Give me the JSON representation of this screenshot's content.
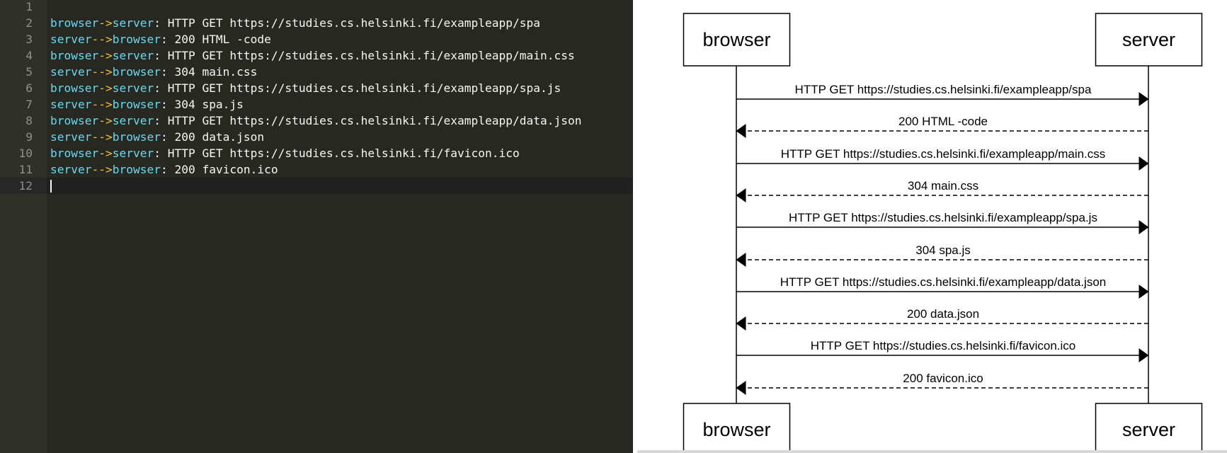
{
  "editor": {
    "lines": [
      {
        "n": "1",
        "tokens": []
      },
      {
        "n": "2",
        "tokens": [
          {
            "t": "browser",
            "c": "actor"
          },
          {
            "t": "->",
            "c": "arrow"
          },
          {
            "t": "server",
            "c": "actor"
          },
          {
            "t": ": HTTP GET https://studies.cs.helsinki.fi/exampleapp/spa",
            "c": "plain"
          }
        ]
      },
      {
        "n": "3",
        "tokens": [
          {
            "t": "server",
            "c": "actor"
          },
          {
            "t": "-->",
            "c": "arrow"
          },
          {
            "t": "browser",
            "c": "actor"
          },
          {
            "t": ": 200 HTML -code",
            "c": "plain"
          }
        ]
      },
      {
        "n": "4",
        "tokens": [
          {
            "t": "browser",
            "c": "actor"
          },
          {
            "t": "->",
            "c": "arrow"
          },
          {
            "t": "server",
            "c": "actor"
          },
          {
            "t": ": HTTP GET https://studies.cs.helsinki.fi/exampleapp/main.css",
            "c": "plain"
          }
        ]
      },
      {
        "n": "5",
        "tokens": [
          {
            "t": "server",
            "c": "actor"
          },
          {
            "t": "-->",
            "c": "arrow"
          },
          {
            "t": "browser",
            "c": "actor"
          },
          {
            "t": ": 304 main.css",
            "c": "plain"
          }
        ]
      },
      {
        "n": "6",
        "tokens": [
          {
            "t": "browser",
            "c": "actor"
          },
          {
            "t": "->",
            "c": "arrow"
          },
          {
            "t": "server",
            "c": "actor"
          },
          {
            "t": ": HTTP GET https://studies.cs.helsinki.fi/exampleapp/spa.js",
            "c": "plain"
          }
        ]
      },
      {
        "n": "7",
        "tokens": [
          {
            "t": "server",
            "c": "actor"
          },
          {
            "t": "-->",
            "c": "arrow"
          },
          {
            "t": "browser",
            "c": "actor"
          },
          {
            "t": ": 304 spa.js",
            "c": "plain"
          }
        ]
      },
      {
        "n": "8",
        "tokens": [
          {
            "t": "browser",
            "c": "actor"
          },
          {
            "t": "->",
            "c": "arrow"
          },
          {
            "t": "server",
            "c": "actor"
          },
          {
            "t": ": HTTP GET https://studies.cs.helsinki.fi/exampleapp/data.json",
            "c": "plain"
          }
        ]
      },
      {
        "n": "9",
        "tokens": [
          {
            "t": "server",
            "c": "actor"
          },
          {
            "t": "-->",
            "c": "arrow"
          },
          {
            "t": "browser",
            "c": "actor"
          },
          {
            "t": ": 200 data.json",
            "c": "plain"
          }
        ]
      },
      {
        "n": "10",
        "tokens": [
          {
            "t": "browser",
            "c": "actor"
          },
          {
            "t": "->",
            "c": "arrow"
          },
          {
            "t": "server",
            "c": "actor"
          },
          {
            "t": ": HTTP GET https://studies.cs.helsinki.fi/favicon.ico",
            "c": "plain"
          }
        ]
      },
      {
        "n": "11",
        "tokens": [
          {
            "t": "server",
            "c": "actor"
          },
          {
            "t": "-->",
            "c": "arrow"
          },
          {
            "t": "browser",
            "c": "actor"
          },
          {
            "t": ": 200 favicon.ico",
            "c": "plain"
          }
        ]
      },
      {
        "n": "12",
        "tokens": [],
        "active": true
      }
    ]
  },
  "diagram": {
    "participants": [
      "browser",
      "server"
    ],
    "messages": [
      {
        "from": "browser",
        "to": "server",
        "text": "HTTP GET https://studies.cs.helsinki.fi/exampleapp/spa",
        "style": "solid"
      },
      {
        "from": "server",
        "to": "browser",
        "text": "200 HTML -code",
        "style": "dashed"
      },
      {
        "from": "browser",
        "to": "server",
        "text": "HTTP GET https://studies.cs.helsinki.fi/exampleapp/main.css",
        "style": "solid"
      },
      {
        "from": "server",
        "to": "browser",
        "text": "304 main.css",
        "style": "dashed"
      },
      {
        "from": "browser",
        "to": "server",
        "text": "HTTP GET https://studies.cs.helsinki.fi/exampleapp/spa.js",
        "style": "solid"
      },
      {
        "from": "server",
        "to": "browser",
        "text": "304 spa.js",
        "style": "dashed"
      },
      {
        "from": "browser",
        "to": "server",
        "text": "HTTP GET https://studies.cs.helsinki.fi/exampleapp/data.json",
        "style": "solid"
      },
      {
        "from": "server",
        "to": "browser",
        "text": "200 data.json",
        "style": "dashed"
      },
      {
        "from": "browser",
        "to": "server",
        "text": "HTTP GET https://studies.cs.helsinki.fi/favicon.ico",
        "style": "solid"
      },
      {
        "from": "server",
        "to": "browser",
        "text": "200 favicon.ico",
        "style": "dashed"
      }
    ]
  },
  "colors": {
    "editor_bg": "#272822",
    "actor": "#66d9ef",
    "arrow": "#f4bf3a",
    "plain": "#f8f8f2"
  }
}
